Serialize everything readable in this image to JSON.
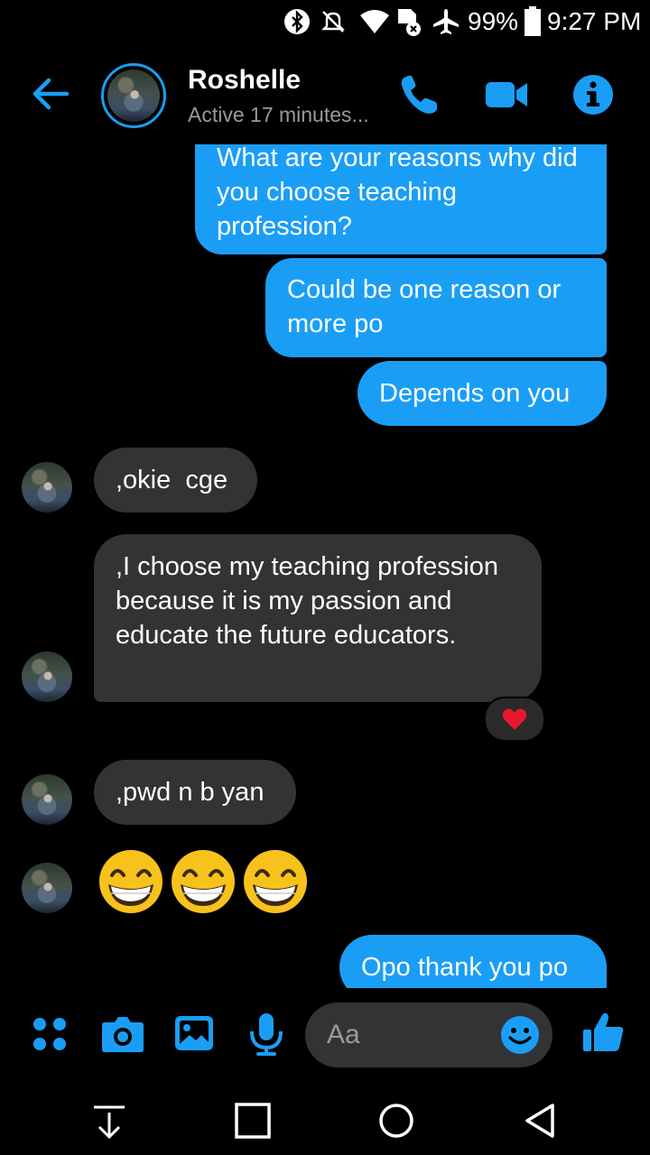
{
  "status_bar": {
    "battery": "99%",
    "time": "9:27 PM"
  },
  "header": {
    "contact_name": "Roshelle",
    "contact_status": "Active 17 minutes..."
  },
  "messages": [
    {
      "side": "out",
      "text": "What are your reasons why did you choose teaching profession?"
    },
    {
      "side": "out",
      "text": "Could be one reason or more po"
    },
    {
      "side": "out",
      "text": "Depends on you"
    },
    {
      "side": "in",
      "text": ",okie  cge"
    },
    {
      "side": "in",
      "text": ",I choose my teaching profession because it is my passion and educate the future educators."
    },
    {
      "side": "in",
      "text": ",pwd n b yan"
    },
    {
      "side": "in",
      "text": "😁😁😁"
    },
    {
      "side": "out",
      "text": "Opo thank you po"
    }
  ],
  "reaction": {
    "icon": "heart-icon",
    "color": "#e8192c"
  },
  "composer": {
    "placeholder": "Aa"
  },
  "colors": {
    "accent": "#1a9ef5",
    "incoming_bubble": "#333333",
    "background": "#000000"
  }
}
